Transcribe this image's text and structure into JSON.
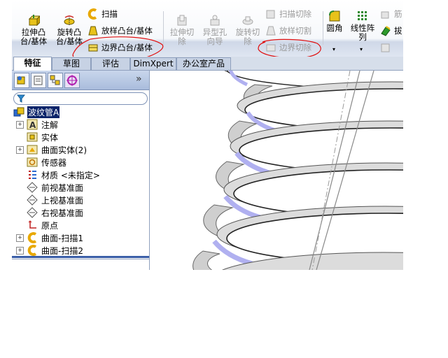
{
  "ribbon": {
    "extrude_boss": "拉伸凸\n台/基体",
    "revolve_boss": "旋转凸\n台/基体",
    "sweep": "扫描",
    "loft_boss": "放样凸台/基体",
    "boundary_boss": "边界凸台/基体",
    "extrude_cut": "拉伸切\n除",
    "hole_wizard": "异型孔\n向导",
    "revolve_cut": "旋转切\n除",
    "sweep_cut": "扫描切除",
    "loft_cut": "放样切割",
    "boundary_cut": "边界切除",
    "fillet": "圆角",
    "linear_pattern": "线性阵\n列",
    "truncated_1": "筋",
    "truncated_2": "拔"
  },
  "tabs": [
    "特征",
    "草图",
    "评估",
    "DimXpert",
    "办公室产品"
  ],
  "active_tab": "特征",
  "panel": {
    "collapse_glyph": "»"
  },
  "tree": {
    "root": "波纹管A",
    "items": [
      {
        "label": "注解",
        "expand": "+"
      },
      {
        "label": "实体",
        "expand": ""
      },
      {
        "label": "曲面实体(2)",
        "expand": "+"
      },
      {
        "label": "传感器",
        "expand": ""
      },
      {
        "label": "材质 <未指定>",
        "expand": ""
      },
      {
        "label": "前视基准面",
        "expand": ""
      },
      {
        "label": "上视基准面",
        "expand": ""
      },
      {
        "label": "右视基准面",
        "expand": ""
      },
      {
        "label": "原点",
        "expand": ""
      },
      {
        "label": "曲面-扫描1",
        "expand": "+"
      },
      {
        "label": "曲面-扫描2",
        "expand": "+"
      }
    ]
  },
  "colors": {
    "highlight_circle": "#e01010",
    "selection": "#0a246a",
    "ribbon_tab_blue": "#8fa0bd",
    "surface_edge_blue": "#a9a9f5"
  }
}
